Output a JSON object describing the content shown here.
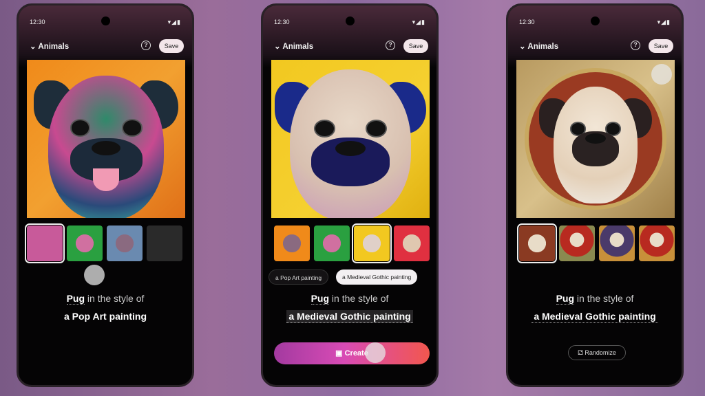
{
  "status_bar": {
    "time": "12:30",
    "icons": "wifi-signal-battery"
  },
  "header": {
    "category": "Animals",
    "help_icon": "?",
    "save_label": "Save"
  },
  "prompt": {
    "subject": "Pug",
    "connector": "in the style of"
  },
  "phones": [
    {
      "style": "a Pop Art painting",
      "thumbnails": [
        "pop-art-pug-1",
        "pop-art-pug-2",
        "pop-art-pug-3",
        "empty"
      ],
      "selected_thumbnail": 0
    },
    {
      "style": "a Medieval Gothic painting",
      "chips": [
        "a Pop Art painting",
        "a Medieval Gothic painting"
      ],
      "selected_chip": 1,
      "create_label": "Create",
      "thumbnails": [
        "pop-art-pug",
        "pop-art-pug-green",
        "gothic-pug",
        "pop-art-pug-red"
      ],
      "selected_thumbnail": 2
    },
    {
      "style": "a Medieval Gothic painting",
      "randomize_label": "Randomize",
      "thumbnails": [
        "gothic-pug-1",
        "gothic-pug-2",
        "gothic-pug-3",
        "gothic-pug-4"
      ],
      "selected_thumbnail": 0
    }
  ],
  "colors": {
    "create_gradient_start": "#a33aa0",
    "create_gradient_end": "#f2574e",
    "save_button": "#f3e6ea"
  }
}
